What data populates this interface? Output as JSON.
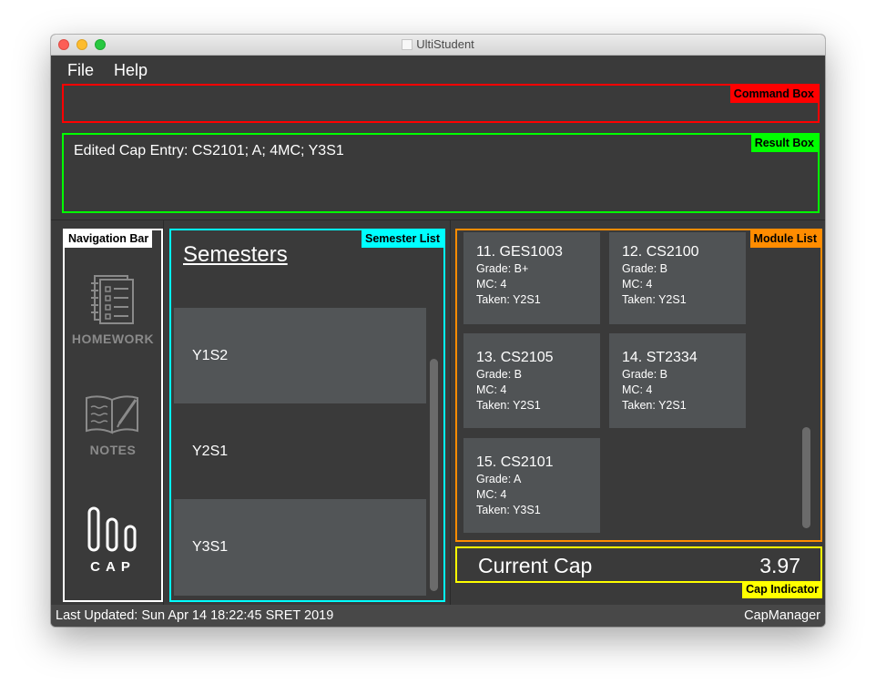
{
  "window": {
    "title": "UltiStudent"
  },
  "menu": {
    "file": "File",
    "help": "Help"
  },
  "command_box": {
    "tag": "Command Box",
    "value": ""
  },
  "result_box": {
    "tag": "Result Box",
    "text": "Edited Cap Entry: CS2101; A; 4MC; Y3S1"
  },
  "navigation_bar": {
    "tag": "Navigation Bar",
    "items": [
      {
        "label": "HOMEWORK",
        "icon": "homework-icon"
      },
      {
        "label": "NOTES",
        "icon": "notes-icon"
      },
      {
        "label": "CAP",
        "icon": "cap-icon"
      }
    ]
  },
  "semester_list": {
    "tag": "Semester List",
    "heading": "Semesters",
    "items": [
      "",
      "Y1S2",
      "Y2S1",
      "Y3S1"
    ]
  },
  "module_list": {
    "tag": "Module List",
    "modules": [
      {
        "title": "11.  GES1003",
        "grade": "Grade: B+",
        "mc": "MC: 4",
        "taken": "Taken: Y2S1"
      },
      {
        "title": "12.  CS2100",
        "grade": "Grade: B",
        "mc": "MC: 4",
        "taken": "Taken: Y2S1"
      },
      {
        "title": "13.  CS2105",
        "grade": "Grade: B",
        "mc": "MC: 4",
        "taken": "Taken: Y2S1"
      },
      {
        "title": "14.  ST2334",
        "grade": "Grade: B",
        "mc": "MC: 4",
        "taken": "Taken: Y2S1"
      },
      {
        "title": "15.  CS2101",
        "grade": "Grade: A",
        "mc": "MC: 4",
        "taken": "Taken: Y3S1"
      }
    ]
  },
  "cap_indicator": {
    "tag": "Cap Indicator",
    "label": "Current Cap",
    "value": "3.97"
  },
  "status_bar": {
    "last_updated": "Last Updated: Sun Apr 14 18:22:45 SRET 2019",
    "app_name": "CapManager"
  },
  "colors": {
    "command_box": "#ff0000",
    "result_box": "#00ff00",
    "navigation_bar": "#ffffff",
    "semester_list": "#00ffff",
    "module_list": "#ff8c00",
    "cap_indicator": "#ffff00"
  }
}
